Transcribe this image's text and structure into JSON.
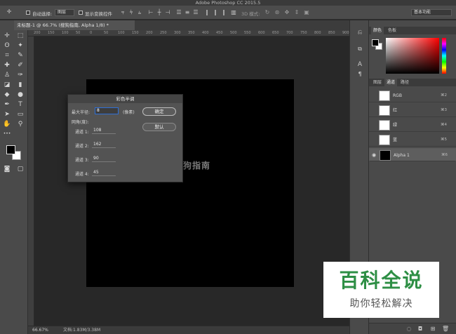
{
  "app": {
    "title": "Adobe Photoshop CC 2015.5"
  },
  "options_bar": {
    "auto_select_label": "自动选择:",
    "auto_select_value": "图层",
    "show_transform_label": "显示变换控件",
    "mode_3d_label": "3D 模式:",
    "workspace": "基本功能"
  },
  "document": {
    "tab_title": "未标题-1 @ 66.7% (搜狗指南, Alpha 1/8) *",
    "canvas_text": "狗指南",
    "ruler_ticks": [
      "200",
      "150",
      "100",
      "50",
      "0",
      "50",
      "100",
      "150",
      "200",
      "250",
      "300",
      "350",
      "400",
      "450",
      "500",
      "550",
      "600",
      "650",
      "700",
      "750",
      "800",
      "850",
      "900"
    ],
    "zoom": "66.67%",
    "doc_info": "文档:1.83M/3.38M"
  },
  "dialog": {
    "title": "彩色半调",
    "max_radius_label": "最大半径:",
    "max_radius_value": "8",
    "unit": "(像素)",
    "angle_label": "网角(度):",
    "channels": [
      {
        "label": "通道 1:",
        "value": "108"
      },
      {
        "label": "通道 2:",
        "value": "162"
      },
      {
        "label": "通道 3:",
        "value": "90"
      },
      {
        "label": "通道 4:",
        "value": "45"
      }
    ],
    "ok_label": "确定",
    "default_label": "默认"
  },
  "color_panel": {
    "tabs": [
      "颜色",
      "色板"
    ]
  },
  "channels_panel": {
    "tabs": [
      "图层",
      "通道",
      "路径"
    ],
    "rows": [
      {
        "name": "RGB",
        "key": "⌘2"
      },
      {
        "name": "红",
        "key": "⌘3"
      },
      {
        "name": "绿",
        "key": "⌘4"
      },
      {
        "name": "蓝",
        "key": "⌘5"
      },
      {
        "name": "Alpha 1",
        "key": "⌘6"
      }
    ]
  },
  "watermark": {
    "main": "百科全说",
    "sub": "助你轻松解决"
  },
  "colors": {
    "accent": "#2f6fd6",
    "watermark_green": "#2e8f45"
  }
}
